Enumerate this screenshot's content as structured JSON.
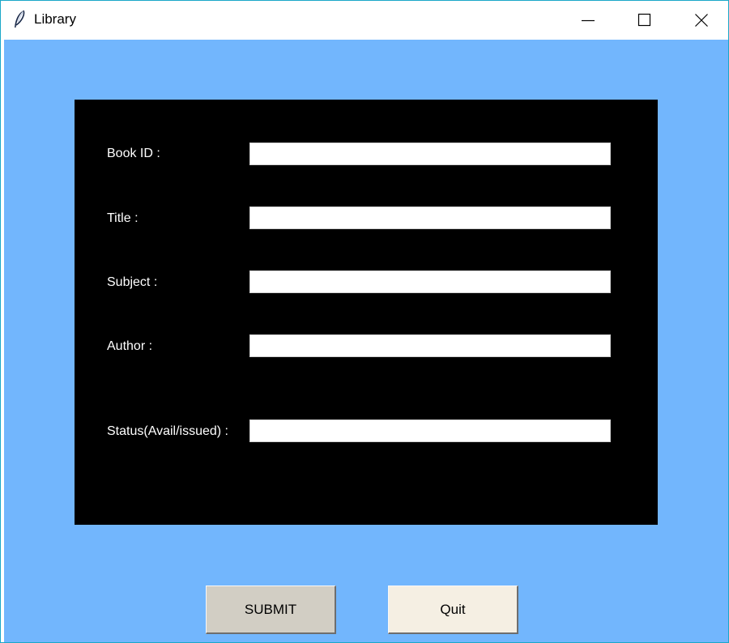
{
  "window": {
    "title": "Library",
    "controls": [
      "minimize-icon",
      "maximize-icon",
      "close-icon"
    ]
  },
  "form": {
    "fields": [
      {
        "label": "Book ID :",
        "value": ""
      },
      {
        "label": "Title :",
        "value": ""
      },
      {
        "label": "Subject :",
        "value": ""
      },
      {
        "label": "Author :",
        "value": ""
      },
      {
        "label": "Status(Avail/issued) :",
        "value": ""
      }
    ]
  },
  "buttons": {
    "submit_label": "SUBMIT",
    "quit_label": "Quit"
  },
  "colors": {
    "background": "#72b6fd",
    "panel": "#000000",
    "submit_button": "#d2cec4",
    "quit_button": "#f5efe3"
  }
}
